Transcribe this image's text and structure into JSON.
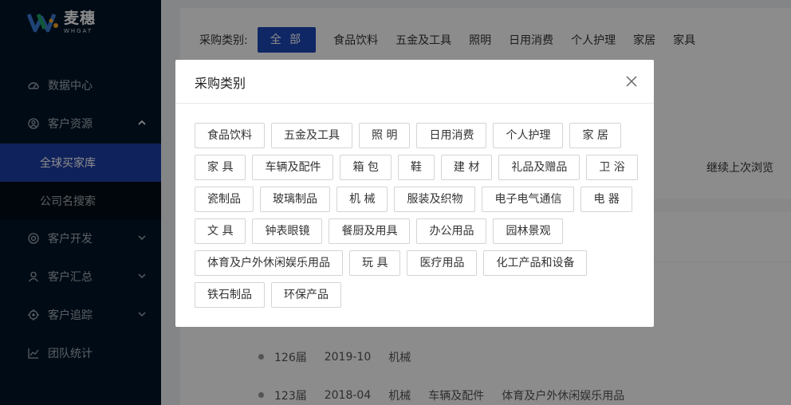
{
  "brand": {
    "name_cn": "麦穗",
    "name_en": "WHGAT"
  },
  "sidebar": {
    "items": [
      {
        "label": "数据中心",
        "icon": "dashboard-icon"
      },
      {
        "label": "客户资源",
        "icon": "user-circle-icon",
        "expanded": true
      },
      {
        "label": "全球买家库",
        "sub": true,
        "active": true
      },
      {
        "label": "公司名搜索",
        "sub": true
      },
      {
        "label": "客户开发",
        "icon": "target-icon"
      },
      {
        "label": "客户汇总",
        "icon": "user-icon"
      },
      {
        "label": "客户追踪",
        "icon": "locate-icon"
      },
      {
        "label": "团队统计",
        "icon": "chart-icon"
      }
    ],
    "bg_color": "#001529",
    "active_color": "#1e3fa6"
  },
  "main": {
    "filter": {
      "label": "采购类别:",
      "options": [
        "全 部",
        "食品饮料",
        "五金及工具",
        "照明",
        "日用消费",
        "个人护理",
        "家居",
        "家具"
      ],
      "active_index": 0
    },
    "continue_browsing": "继续上次浏览",
    "records": [
      {
        "session": "126届",
        "date": "2019-10",
        "categories": [
          "机械"
        ]
      },
      {
        "session": "123届",
        "date": "2018-04",
        "categories": [
          "机械",
          "车辆及配件",
          "体育及户外休闲娱乐用品"
        ]
      }
    ]
  },
  "modal": {
    "title": "采购类别",
    "tags": [
      "食品饮料",
      "五金及工具",
      "照 明",
      "日用消费",
      "个人护理",
      "家 居",
      "家 具",
      "车辆及配件",
      "箱 包",
      "鞋",
      "建 材",
      "礼品及赠品",
      "卫 浴",
      "瓷制品",
      "玻璃制品",
      "机 械",
      "服装及织物",
      "电子电气通信",
      "电 器",
      "文 具",
      "钟表眼镜",
      "餐厨及用具",
      "办公用品",
      "园林景观",
      "体育及户外休闲娱乐用品",
      "玩 具",
      "医疗用品",
      "化工产品和设备",
      "铁石制品",
      "环保产品"
    ]
  }
}
